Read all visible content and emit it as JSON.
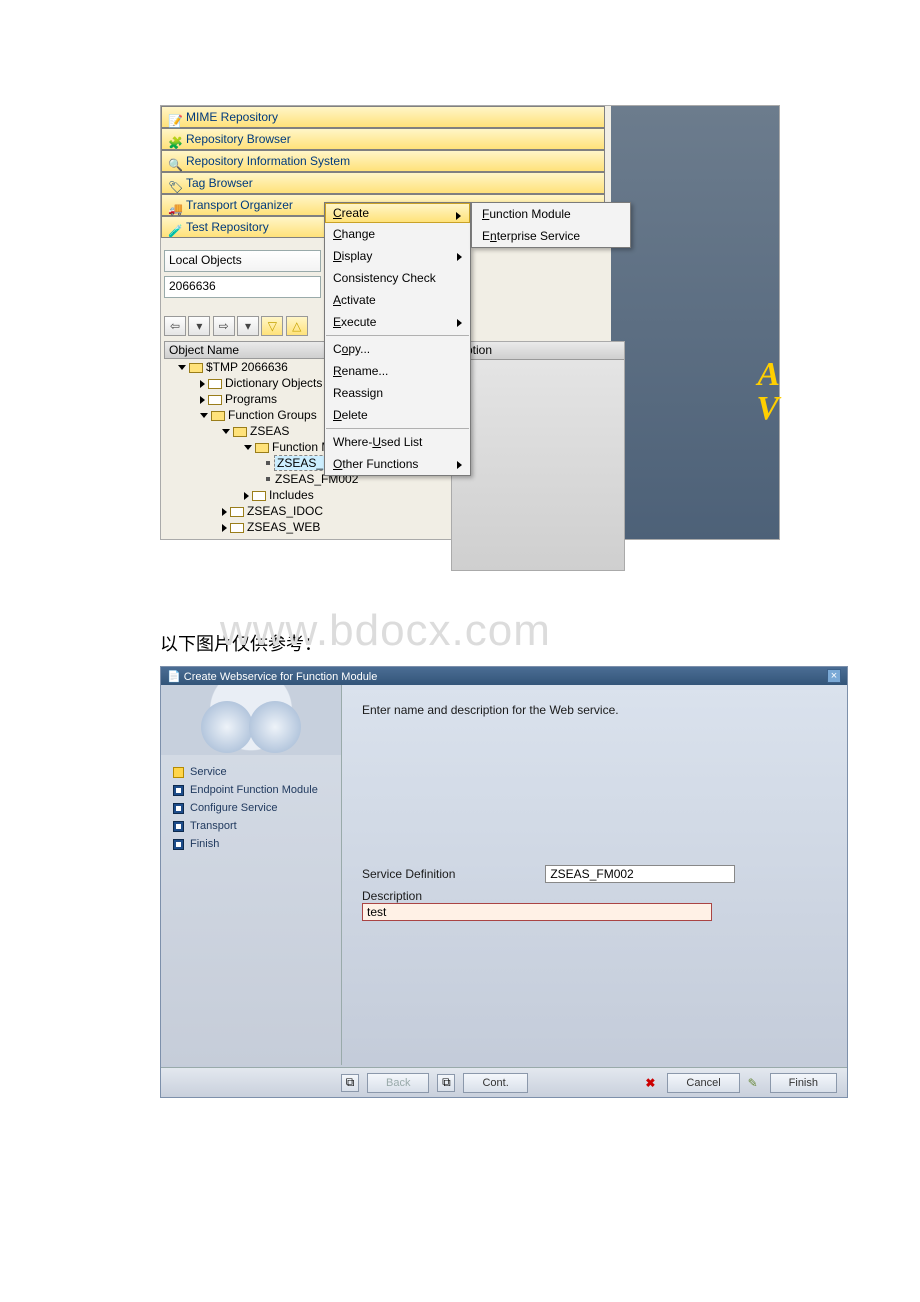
{
  "nav": [
    {
      "label": "MIME Repository"
    },
    {
      "label": "Repository Browser"
    },
    {
      "label": "Repository Information System"
    },
    {
      "label": "Tag Browser"
    },
    {
      "label": "Transport Organizer"
    },
    {
      "label": "Test Repository"
    }
  ],
  "filter": {
    "label": "Local Objects",
    "value": "2066636"
  },
  "tree": {
    "header_obj": "Object Name",
    "header_desc": "tription",
    "root": "$TMP 2066636",
    "dict": "Dictionary Objects",
    "programs": "Programs",
    "fg": "Function Groups",
    "zseas": "ZSEAS",
    "fm": "Function M",
    "fm1": "ZSEAS_FM001",
    "fm2": "ZSEAS_FM002",
    "includes": "Includes",
    "idoc": "ZSEAS_IDOC",
    "web": "ZSEAS_WEB"
  },
  "ctx": {
    "create": "Create",
    "change": "Change",
    "display": "Display",
    "consistency": "Consistency Check",
    "activate": "Activate",
    "execute": "Execute",
    "copy": "Copy...",
    "rename": "Rename...",
    "reassign": "Reassign",
    "delete": "Delete",
    "where": "Where-Used List",
    "other": "Other Functions"
  },
  "sub": {
    "fm": "Function Module",
    "es": "Enterprise Service"
  },
  "caption": "以下图片仅供参考：",
  "watermark": "www.bdocx.com",
  "wizard": {
    "title": "Create Webservice for Function Module",
    "instruction": "Enter name and description for the Web service.",
    "steps": [
      "Service",
      "Endpoint Function Module",
      "Configure Service",
      "Transport",
      "Finish"
    ],
    "form": {
      "def_label": "Service Definition",
      "def_value": "ZSEAS_FM002",
      "desc_label": "Description",
      "desc_value": "test"
    },
    "buttons": {
      "back": "Back",
      "cont": "Cont.",
      "cancel": "Cancel",
      "finish": "Finish"
    }
  }
}
